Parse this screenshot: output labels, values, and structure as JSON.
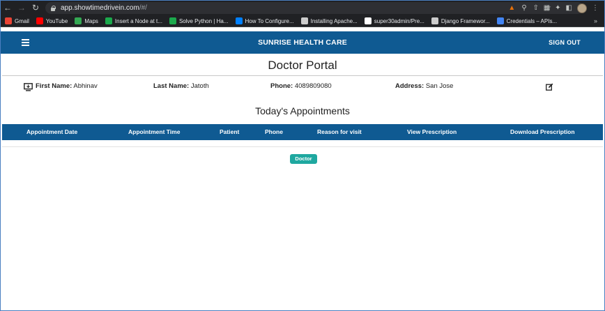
{
  "browser": {
    "url_host": "app.showtimedrivein.com",
    "url_path": "/#/",
    "bookmarks": [
      {
        "label": "Gmail",
        "icon": "gmail-icon",
        "color": "#ea4335"
      },
      {
        "label": "YouTube",
        "icon": "youtube-icon",
        "color": "#ff0000"
      },
      {
        "label": "Maps",
        "icon": "maps-icon",
        "color": "#34a853"
      },
      {
        "label": "Insert a Node at t...",
        "icon": "hackerrank-icon",
        "color": "#1ba94c"
      },
      {
        "label": "Solve Python | Ha...",
        "icon": "hackerrank-icon",
        "color": "#1ba94c"
      },
      {
        "label": "How To Configure...",
        "icon": "digitalocean-icon",
        "color": "#0080ff"
      },
      {
        "label": "Installing Apache...",
        "icon": "doc-icon",
        "color": "#cccccc"
      },
      {
        "label": "super30admin/Pre...",
        "icon": "github-icon",
        "color": "#ffffff"
      },
      {
        "label": "Django Framewor...",
        "icon": "doc-icon",
        "color": "#cccccc"
      },
      {
        "label": "Credentials – APIs...",
        "icon": "api-icon",
        "color": "#4285f4"
      }
    ],
    "more": "»"
  },
  "app": {
    "brand": "SUNRISE HEALTH CARE",
    "sign_out": "SIGN OUT",
    "accent": "#0f5a92"
  },
  "portal": {
    "title": "Doctor Portal",
    "first_name_label": "First Name:",
    "first_name": "Abhinav",
    "last_name_label": "Last Name:",
    "last_name": "Jatoth",
    "phone_label": "Phone:",
    "phone": "4089809080",
    "address_label": "Address:",
    "address": "San Jose"
  },
  "appointments": {
    "title": "Today's Appointments",
    "columns": [
      "Appointment Date",
      "Appointment Time",
      "Patient",
      "Phone",
      "Reason for visit",
      "View Prescription",
      "Download Prescription"
    ],
    "rows": []
  },
  "role_badge": {
    "label": "Doctor",
    "color": "#1fa8a0"
  }
}
